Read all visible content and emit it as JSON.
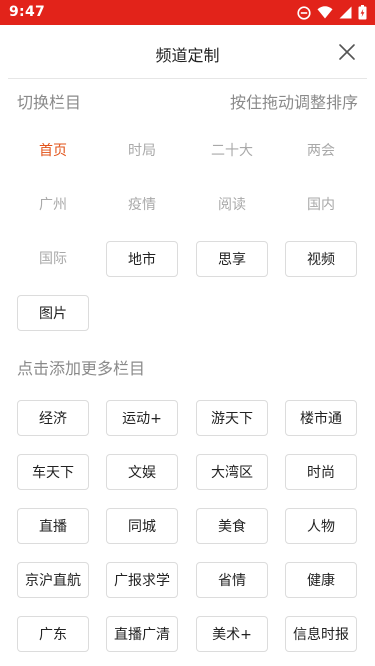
{
  "status_bar": {
    "time": "9:47",
    "background": "#e2231a",
    "icons": [
      "do-not-disturb-icon",
      "wifi-icon",
      "signal-icon",
      "battery-icon"
    ]
  },
  "header": {
    "title": "频道定制",
    "close_icon": "close-icon"
  },
  "my_channels": {
    "heading": "切换栏目",
    "hint": "按住拖动调整排序",
    "items": [
      {
        "label": "首页",
        "state": "active"
      },
      {
        "label": "时局",
        "state": "fixed"
      },
      {
        "label": "二十大",
        "state": "fixed"
      },
      {
        "label": "两会",
        "state": "fixed"
      },
      {
        "label": "广州",
        "state": "fixed"
      },
      {
        "label": "疫情",
        "state": "fixed"
      },
      {
        "label": "阅读",
        "state": "fixed"
      },
      {
        "label": "国内",
        "state": "fixed"
      },
      {
        "label": "国际",
        "state": "fixed"
      },
      {
        "label": "地市",
        "state": "boxed"
      },
      {
        "label": "思享",
        "state": "boxed"
      },
      {
        "label": "视频",
        "state": "boxed"
      },
      {
        "label": "图片",
        "state": "boxed"
      }
    ]
  },
  "more_channels": {
    "heading": "点击添加更多栏目",
    "items": [
      "经济",
      "运动+",
      "游天下",
      "楼市通",
      "车天下",
      "文娱",
      "大湾区",
      "时尚",
      "直播",
      "同城",
      "美食",
      "人物",
      "京沪直航",
      "广报求学",
      "省情",
      "健康",
      "广东",
      "直播广清",
      "美术+",
      "信息时报"
    ]
  },
  "colors": {
    "accent": "#e2531a",
    "muted_text": "#a9a9a9",
    "chip_border": "#dcdcdc"
  }
}
